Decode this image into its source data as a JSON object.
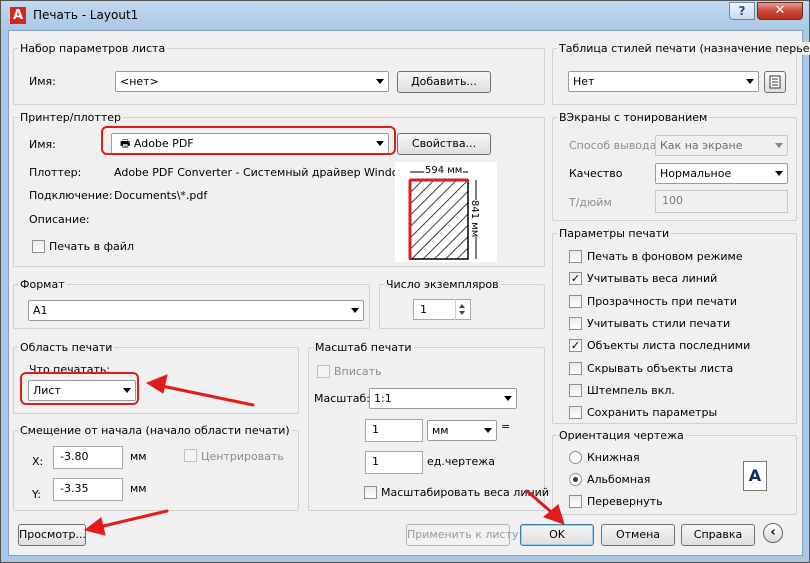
{
  "window": {
    "title": "Печать - Layout1",
    "help": "?",
    "close": "✕",
    "app_icon": "A"
  },
  "page_setup": {
    "group": "Набор параметров листа",
    "name_label": "Имя:",
    "value": "<нет>",
    "add_button": "Добавить..."
  },
  "printer": {
    "group": "Принтер/плоттер",
    "name_label": "Имя:",
    "name_value": "Adobe PDF",
    "properties_button": "Свойства...",
    "plotter_label": "Плоттер:",
    "plotter_value": "Adobe PDF Converter - Системный драйвер Windo...",
    "port_label": "Подключение:",
    "port_value": "Documents\\*.pdf",
    "desc_label": "Описание:",
    "print_to_file": "Печать в файл",
    "width_label": "594 мм",
    "height_label": "841 мм"
  },
  "paper": {
    "group": "Формат",
    "value": "A1"
  },
  "copies": {
    "group": "Число экземпляров",
    "value": "1"
  },
  "plot_area": {
    "group": "Область печати",
    "what_label": "Что печатать:",
    "value": "Лист"
  },
  "offset": {
    "group": "Смещение от начала (начало области печати)",
    "x_label": "X:",
    "x_value": "-3.80",
    "x_unit": "мм",
    "center": "Центрировать",
    "y_label": "Y:",
    "y_value": "-3.35",
    "y_unit": "мм"
  },
  "scale": {
    "group": "Масштаб печати",
    "fit": "Вписать",
    "scale_label": "Масштаб:",
    "scale_value": "1:1",
    "num_value": "1",
    "unit_value": "мм",
    "equals": "=",
    "den_value": "1",
    "den_unit": "ед.чертежа",
    "lineweights": "Масштабировать веса линий"
  },
  "style_table": {
    "group": "Таблица стилей печати (назначение перьев)",
    "value": "Нет"
  },
  "shaded": {
    "group": "ВЭкраны с тонированием",
    "output_label": "Способ вывода",
    "output_value": "Как на экране",
    "quality_label": "Качество",
    "quality_value": "Нормальное",
    "dpi_label": "Т/дюйм",
    "dpi_value": "100"
  },
  "options": {
    "group": "Параметры печати",
    "items": [
      {
        "label": "Печать в фоновом режиме",
        "checked": false
      },
      {
        "label": "Учитывать веса линий",
        "checked": true
      },
      {
        "label": "Прозрачность при печати",
        "checked": false
      },
      {
        "label": "Учитывать стили печати",
        "checked": false
      },
      {
        "label": "Объекты листа последними",
        "checked": true
      },
      {
        "label": "Скрывать объекты листа",
        "checked": false
      },
      {
        "label": "Штемпель вкл.",
        "checked": false
      },
      {
        "label": "Сохранить параметры",
        "checked": false
      }
    ]
  },
  "orientation": {
    "group": "Ориентация чертежа",
    "portrait": "Книжная",
    "landscape": "Альбомная",
    "upside_down": "Перевернуть",
    "icon": "A"
  },
  "footer": {
    "preview": "Просмотр...",
    "apply": "Применить к листу",
    "ok": "OK",
    "cancel": "Отмена",
    "help": "Справка",
    "expand": "‹"
  },
  "colors": {
    "annotation": "#e21c1c",
    "title_bar": "#a9c7e6"
  }
}
